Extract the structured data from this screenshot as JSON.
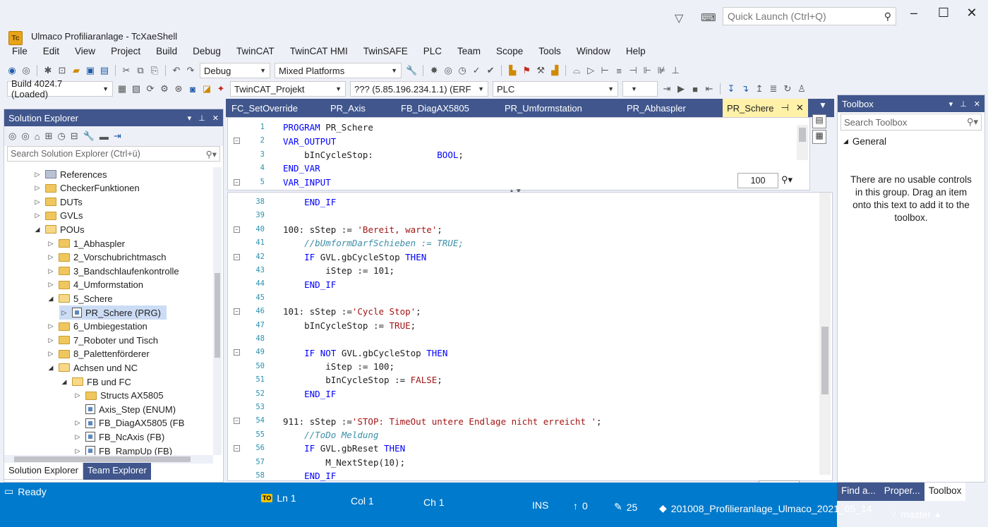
{
  "window": {
    "title": "Ulmaco Profiliaranlage - TcXaeShell"
  },
  "quick_launch": {
    "placeholder": "Quick Launch (Ctrl+Q)"
  },
  "menu": [
    "File",
    "Edit",
    "View",
    "Project",
    "Build",
    "Debug",
    "TwinCAT",
    "TwinCAT HMI",
    "TwinSAFE",
    "PLC",
    "Team",
    "Scope",
    "Tools",
    "Window",
    "Help"
  ],
  "toolbar": {
    "config": "Debug",
    "platform": "Mixed Platforms",
    "build": "Build 4024.7 (Loaded)",
    "project": "TwinCAT_Projekt",
    "target": "??? (5.85.196.234.1.1) (ERF",
    "plc": "PLC"
  },
  "solution_explorer": {
    "title": "Solution Explorer",
    "search_placeholder": "Search Solution Explorer (Ctrl+ü)",
    "items": [
      {
        "label": "References",
        "indent": 1,
        "type": "ref",
        "expander": "▷"
      },
      {
        "label": "CheckerFunktionen",
        "indent": 1,
        "type": "folder",
        "expander": "▷"
      },
      {
        "label": "DUTs",
        "indent": 1,
        "type": "folder",
        "expander": "▷"
      },
      {
        "label": "GVLs",
        "indent": 1,
        "type": "folder",
        "expander": "▷"
      },
      {
        "label": "POUs",
        "indent": 1,
        "type": "folder-open",
        "expander": "◢"
      },
      {
        "label": "1_Abhaspler",
        "indent": 2,
        "type": "folder",
        "expander": "▷"
      },
      {
        "label": "2_Vorschubrichtmasch",
        "indent": 2,
        "type": "folder",
        "expander": "▷"
      },
      {
        "label": "3_Bandschlaufenkontrolle",
        "indent": 2,
        "type": "folder",
        "expander": "▷"
      },
      {
        "label": "4_Umformstation",
        "indent": 2,
        "type": "folder",
        "expander": "▷"
      },
      {
        "label": "5_Schere",
        "indent": 2,
        "type": "folder-open",
        "expander": "◢"
      },
      {
        "label": "PR_Schere (PRG)",
        "indent": 3,
        "type": "file",
        "expander": "▷",
        "selected": true
      },
      {
        "label": "6_Umbiegestation",
        "indent": 2,
        "type": "folder",
        "expander": "▷"
      },
      {
        "label": "7_Roboter und Tisch",
        "indent": 2,
        "type": "folder",
        "expander": "▷"
      },
      {
        "label": "8_Palettenförderer",
        "indent": 2,
        "type": "folder",
        "expander": "▷"
      },
      {
        "label": "Achsen und NC",
        "indent": 2,
        "type": "folder-open",
        "expander": "◢"
      },
      {
        "label": "FB und FC",
        "indent": 3,
        "type": "folder-open",
        "expander": "◢"
      },
      {
        "label": "Structs AX5805",
        "indent": 4,
        "type": "folder",
        "expander": "▷"
      },
      {
        "label": "Axis_Step (ENUM)",
        "indent": 4,
        "type": "file",
        "expander": ""
      },
      {
        "label": "FB_DiagAX5805 (FB",
        "indent": 4,
        "type": "file",
        "expander": "▷"
      },
      {
        "label": "FB_NcAxis (FB)",
        "indent": 4,
        "type": "file",
        "expander": "▷"
      },
      {
        "label": "FB_RampUp (FB)",
        "indent": 4,
        "type": "file",
        "expander": "▷"
      }
    ],
    "tabs": [
      "Solution Explorer",
      "Team Explorer"
    ]
  },
  "editor": {
    "tabs": [
      "FC_SetOverride",
      "PR_Axis",
      "FB_DiagAX5805",
      "PR_Umformstation",
      "PR_Abhaspler",
      "PR_Schere"
    ],
    "active_tab": "PR_Schere",
    "decl_lines": [
      {
        "n": "1",
        "text": "PROGRAM PR_Schere",
        "cls": "kw-start"
      },
      {
        "n": "2",
        "text": "VAR_OUTPUT",
        "cls": "kw"
      },
      {
        "n": "3",
        "text": "    bInCycleStop:            BOOL;",
        "cls": "decl"
      },
      {
        "n": "4",
        "text": "END_VAR",
        "cls": "kw"
      },
      {
        "n": "5",
        "text": "VAR_INPUT",
        "cls": "kw"
      }
    ],
    "code_lines": [
      {
        "n": "38",
        "text": "    END_IF"
      },
      {
        "n": "39",
        "text": ""
      },
      {
        "n": "40",
        "text": "100: sStep := 'Bereit, warte';"
      },
      {
        "n": "41",
        "text": "    //bUmformDarfSchieben := TRUE;"
      },
      {
        "n": "42",
        "text": "    IF GVL.gbCycleStop THEN"
      },
      {
        "n": "43",
        "text": "        iStep := 101;"
      },
      {
        "n": "44",
        "text": "    END_IF"
      },
      {
        "n": "45",
        "text": ""
      },
      {
        "n": "46",
        "text": "101: sStep :='Cycle Stop';"
      },
      {
        "n": "47",
        "text": "    bInCycleStop := TRUE;"
      },
      {
        "n": "48",
        "text": ""
      },
      {
        "n": "49",
        "text": "    IF NOT GVL.gbCycleStop THEN"
      },
      {
        "n": "50",
        "text": "        iStep := 100;"
      },
      {
        "n": "51",
        "text": "        bInCycleStop := FALSE;"
      },
      {
        "n": "52",
        "text": "    END_IF"
      },
      {
        "n": "53",
        "text": ""
      },
      {
        "n": "54",
        "text": "911: sStep :='STOP: TimeOut untere Endlage nicht erreicht ';"
      },
      {
        "n": "55",
        "text": "    //ToDo Meldung"
      },
      {
        "n": "56",
        "text": "    IF GVL.gbReset THEN"
      },
      {
        "n": "57",
        "text": "        M_NextStep(10);"
      },
      {
        "n": "58",
        "text": "    END_IF"
      }
    ],
    "zoom_top": "100",
    "zoom_bottom": "100"
  },
  "toolbox": {
    "title": "Toolbox",
    "search_placeholder": "Search Toolbox",
    "group": "General",
    "message": "There are no usable controls in this group. Drag an item onto this text to add it to the toolbox.",
    "tabs": [
      "Find a...",
      "Proper...",
      "Toolbox"
    ]
  },
  "status": {
    "ready": "Ready",
    "ln": "Ln 1",
    "col": "Col 1",
    "ch": "Ch 1",
    "ins": "INS",
    "up": "0",
    "edits": "25",
    "repo": "201008_Profilieranlage_Ulmaco_2021_05_14",
    "branch": "master"
  },
  "colors": {
    "accent": "#007acc",
    "panel_header": "#40568d",
    "active_tab": "#fff1a8"
  }
}
